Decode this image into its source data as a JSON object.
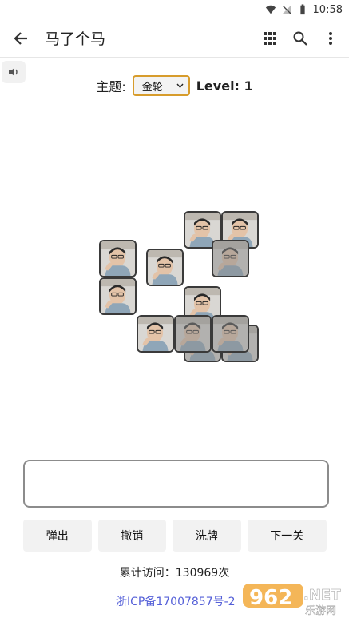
{
  "status_bar": {
    "time": "10:58"
  },
  "app_bar": {
    "title": "马了个马",
    "back_icon": "arrow-back-icon",
    "actions": [
      "grid-icon",
      "search-icon",
      "more-vert-icon"
    ]
  },
  "sound_toggle": {
    "icon": "volume-icon"
  },
  "theme": {
    "label": "主题:",
    "selected": "金轮"
  },
  "level": {
    "text": "Level: 1"
  },
  "tiles": [
    {
      "dim": false
    },
    {
      "dim": false
    },
    {
      "dim": true
    },
    {
      "dim": false
    },
    {
      "dim": false
    },
    {
      "dim": false
    },
    {
      "dim": false
    },
    {
      "dim": true
    },
    {
      "dim": true
    },
    {
      "dim": true
    },
    {
      "dim": true
    },
    {
      "dim": true
    }
  ],
  "buttons": {
    "pop": "弹出",
    "undo": "撤销",
    "shuffle": "洗牌",
    "next": "下一关"
  },
  "footer": {
    "visits": "累计访问：130969次",
    "icp": "浙ICP备17007857号-2"
  },
  "watermark": {
    "text": "962",
    "net": ".NET",
    "sub": "乐游网"
  },
  "colors": {
    "accent": "#d79c2c",
    "link": "#5560d8",
    "button_bg": "#f2f2f2"
  }
}
